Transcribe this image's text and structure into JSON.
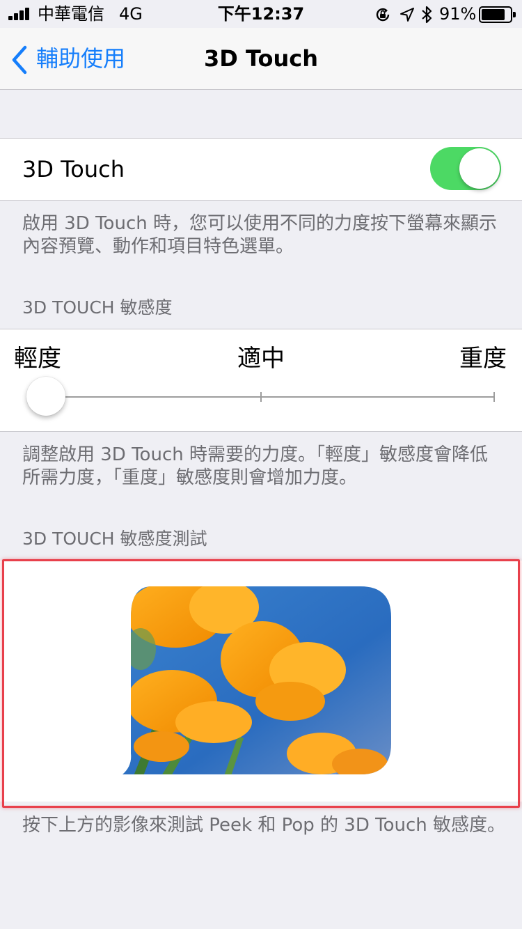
{
  "status_bar": {
    "carrier": "中華電信",
    "network": "4G",
    "time": "下午12:37",
    "battery_percent": "91%",
    "battery_level": 0.91,
    "icons": [
      "signal-bars-icon",
      "orientation-lock-icon",
      "location-icon",
      "bluetooth-icon",
      "battery-icon"
    ]
  },
  "nav": {
    "back_label": "輔助使用",
    "title": "3D Touch"
  },
  "toggle_cell": {
    "label": "3D Touch",
    "enabled": true
  },
  "toggle_footer": {
    "line1": "啟用 3D Touch 時，您可以使用不同的力度按下螢幕來顯示",
    "line2": "內容預覽、動作和項目特色選單。"
  },
  "sensitivity": {
    "header": "3D TOUCH 敏感度",
    "labels": [
      "輕度",
      "適中",
      "重度"
    ],
    "selected": "輕度",
    "footer_line1": "調整啟用 3D Touch 時需要的力度。「輕度」敏感度會降低",
    "footer_line2": "所需力度，「重度」敏感度則會增加力度。"
  },
  "test": {
    "header": "3D TOUCH 敏感度測試",
    "footer": "按下上方的影像來測試 Peek 和 Pop 的 3D Touch 敏感度。"
  },
  "colors": {
    "accent": "#157efb",
    "toggle_on": "#4cd964",
    "highlight": "#e8404b",
    "background": "#efeff4"
  }
}
